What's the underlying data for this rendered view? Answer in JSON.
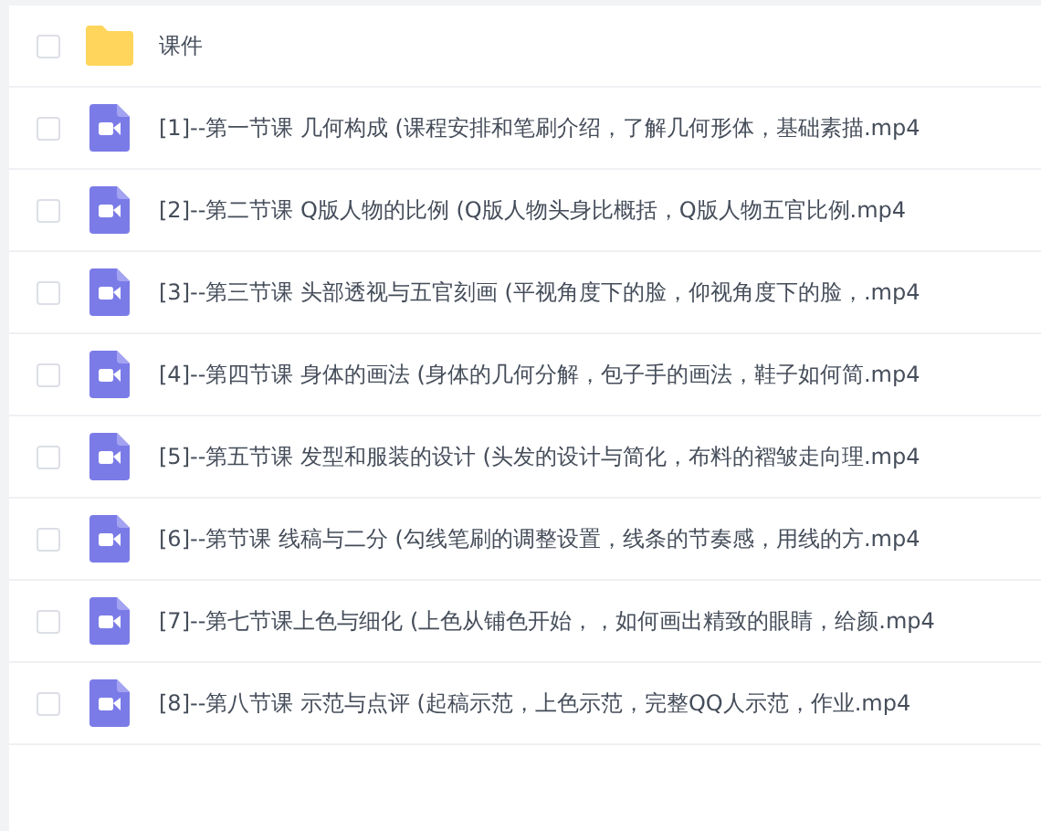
{
  "files": [
    {
      "kind": "folder",
      "name": "课件",
      "checked": false
    },
    {
      "kind": "video",
      "name": "[1]--第一节课 几何构成 (课程安排和笔刷介绍，了解几何形体，基础素描.mp4",
      "checked": false
    },
    {
      "kind": "video",
      "name": "[2]--第二节课 Q版人物的比例 (Q版人物头身比概括，Q版人物五官比例.mp4",
      "checked": false
    },
    {
      "kind": "video",
      "name": "[3]--第三节课 头部透视与五官刻画 (平视角度下的脸，仰视角度下的脸，.mp4",
      "checked": false
    },
    {
      "kind": "video",
      "name": "[4]--第四节课 身体的画法 (身体的几何分解，包子手的画法，鞋子如何简.mp4",
      "checked": false
    },
    {
      "kind": "video",
      "name": "[5]--第五节课 发型和服装的设计 (头发的设计与简化，布料的褶皱走向理.mp4",
      "checked": false
    },
    {
      "kind": "video",
      "name": "[6]--第节课 线稿与二分 (勾线笔刷的调整设置，线条的节奏感，用线的方.mp4",
      "checked": false
    },
    {
      "kind": "video",
      "name": "[7]--第七节课上色与细化 (上色从铺色开始，，如何画出精致的眼睛，给颜.mp4",
      "checked": false
    },
    {
      "kind": "video",
      "name": "[8]--第八节课 示范与点评 (起稿示范，上色示范，完整QQ人示范，作业.mp4",
      "checked": false
    }
  ]
}
